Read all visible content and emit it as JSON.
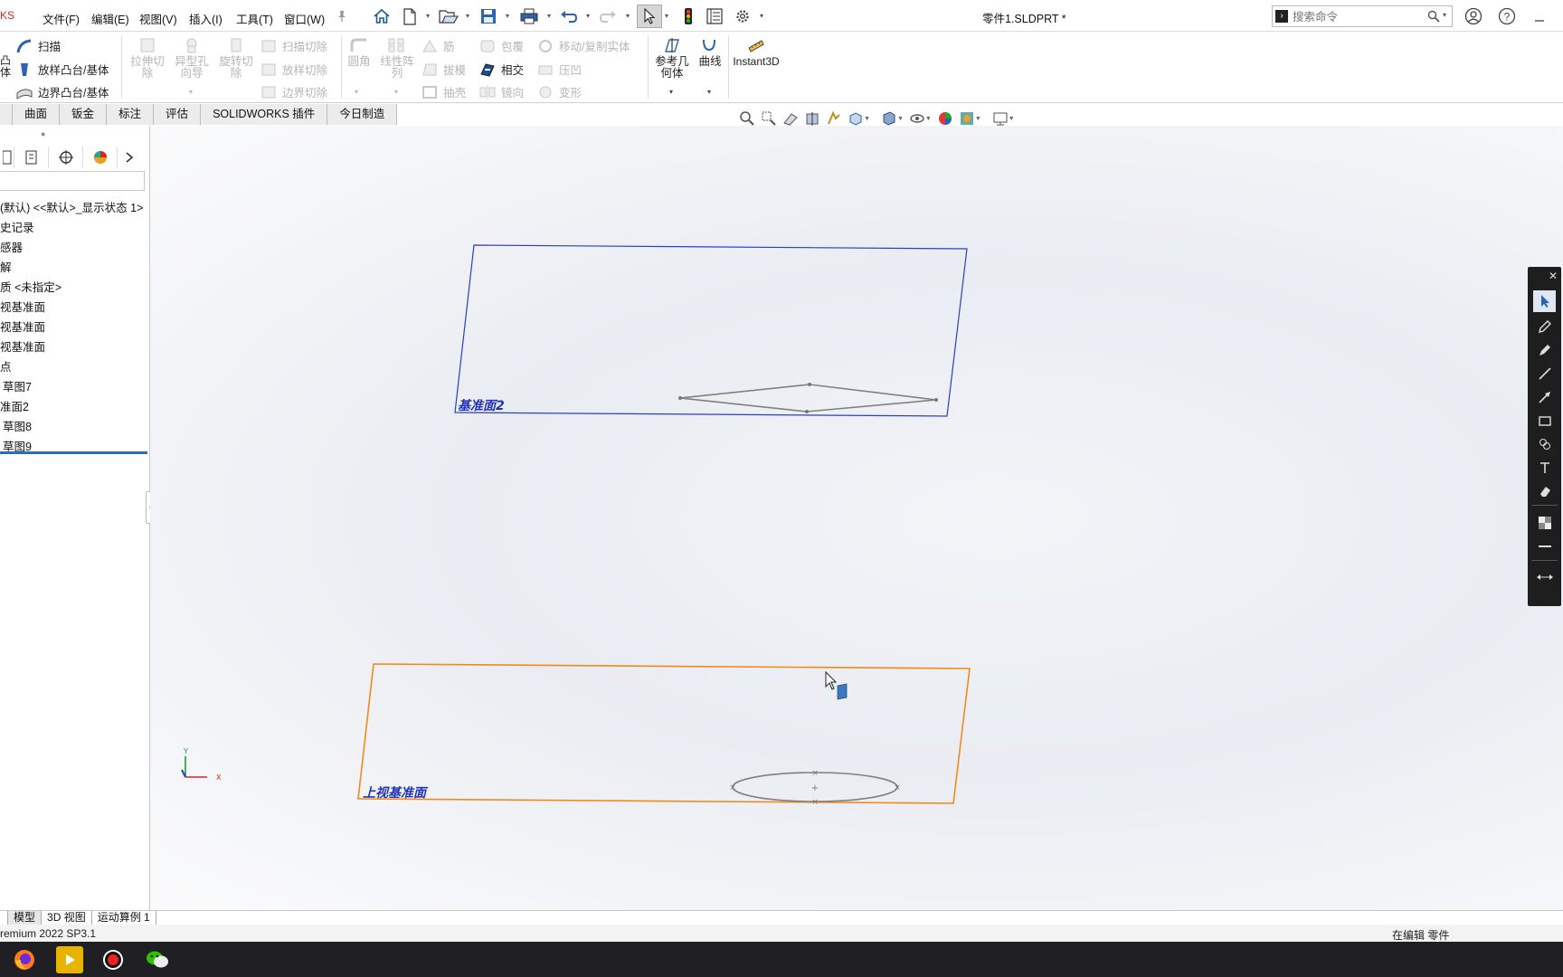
{
  "app": {
    "brand_fragment": "KS",
    "document_title": "零件1.SLDPRT *",
    "search_placeholder": "搜索命令"
  },
  "menus": [
    "文件(F)",
    "编辑(E)",
    "视图(V)",
    "插入(I)",
    "工具(T)",
    "窗口(W)"
  ],
  "ribbon": {
    "left_partial": [
      "凸",
      "体"
    ],
    "sweep": "扫描",
    "loft_boss": "放样凸台/基体",
    "boundary_boss": "边界凸台/基体",
    "extruded_cut": "拉伸切\n除",
    "hole_wizard": "异型孔\n向导",
    "revolved_cut": "旋转切\n除",
    "swept_cut": "扫描切除",
    "lofted_cut": "放样切除",
    "boundary_cut": "边界切除",
    "fillet": "圆角",
    "linear_pattern": "线性阵\n列",
    "rib": "筋",
    "draft": "拔模",
    "shell": "抽壳",
    "wrap": "包覆",
    "intersect": "相交",
    "mirror": "镜向",
    "move_copy_body": "移动/复制实体",
    "indent": "压凹",
    "flex": "变形",
    "reference_geometry": "参考几\n何体",
    "curves": "曲线",
    "instant3d": "Instant3D"
  },
  "tabs": [
    "曲面",
    "钣金",
    "标注",
    "评估",
    "SOLIDWORKS 插件",
    "今日制造"
  ],
  "feature_tree": [
    "(默认) <<默认>_显示状态 1>",
    "史记录",
    "感器",
    "解",
    "质 <未指定>",
    "视基准面",
    "视基准面",
    "视基准面",
    "点",
    "草图7",
    "准面2",
    "草图8",
    "草图9"
  ],
  "viewport": {
    "plane_upper_label": "基准面2",
    "plane_lower_label": "上视基准面",
    "triad_y": "Y",
    "triad_x": "X",
    "colors": {
      "plane_upper": "#2b3fc0",
      "plane_lower": "#f08a1c",
      "plane_label": "#2233bb",
      "sketch": "#808080"
    }
  },
  "bottom_tabs": [
    "模型",
    "3D 视图",
    "运动算例 1"
  ],
  "status": {
    "version": "remium 2022 SP3.1",
    "mode": "在编辑 零件"
  }
}
